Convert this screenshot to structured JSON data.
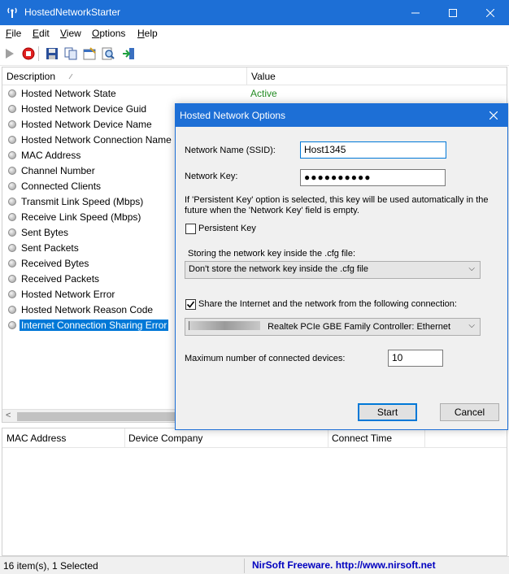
{
  "window": {
    "title": "HostedNetworkStarter"
  },
  "menu": {
    "file": {
      "ul": "F",
      "rest": "ile"
    },
    "edit": {
      "ul": "E",
      "rest": "dit"
    },
    "view": {
      "ul": "V",
      "rest": "iew"
    },
    "options": {
      "ul": "O",
      "rest": "ptions"
    },
    "help": {
      "ul": "H",
      "rest": "elp"
    }
  },
  "list": {
    "col_description": "Description",
    "col_value": "Value",
    "rows": [
      {
        "label": "Hosted Network State",
        "value": "Active"
      },
      {
        "label": "Hosted Network Device Guid"
      },
      {
        "label": "Hosted Network Device Name"
      },
      {
        "label": "Hosted Network Connection Name"
      },
      {
        "label": "MAC Address"
      },
      {
        "label": "Channel Number"
      },
      {
        "label": "Connected Clients"
      },
      {
        "label": "Transmit Link Speed (Mbps)"
      },
      {
        "label": "Receive Link Speed (Mbps)"
      },
      {
        "label": "Sent Bytes"
      },
      {
        "label": "Sent Packets"
      },
      {
        "label": "Received Bytes"
      },
      {
        "label": "Received Packets"
      },
      {
        "label": "Hosted Network Error"
      },
      {
        "label": "Hosted Network Reason Code"
      },
      {
        "label": "Internet Connection Sharing Error"
      }
    ]
  },
  "lower": {
    "col_mac": "MAC Address",
    "col_company": "Device Company",
    "col_time": "Connect Time"
  },
  "status": {
    "items": "16 item(s), 1 Selected",
    "link": "NirSoft Freeware.  http://www.nirsoft.net"
  },
  "dialog": {
    "title": "Hosted Network Options",
    "ssid_label": "Network Name (SSID):",
    "ssid_value": "Host1345",
    "key_label": "Network Key:",
    "key_value": "●●●●●●●●●●",
    "info_line1": "If 'Persistent Key' option is selected, this key will be used automatically in the",
    "info_line2": "future when the 'Network Key' field is empty.",
    "persistent_label": "Persistent Key",
    "persistent_checked": false,
    "storing_label": "Storing the network key inside the .cfg file:",
    "storing_value": "Don't store the network key inside the .cfg file",
    "share_label": "Share the Internet and the network from the following connection:",
    "share_checked": true,
    "connection_value": "Realtek PCIe GBE Family Controller: Ethernet",
    "max_label": "Maximum number of connected devices:",
    "max_value": "10",
    "start_label": "Start",
    "cancel_label": "Cancel"
  },
  "colors": {
    "titlebar": "#1d6fd6",
    "selection": "#0078d7",
    "active_value": "#228b22",
    "link": "#0000c0"
  }
}
